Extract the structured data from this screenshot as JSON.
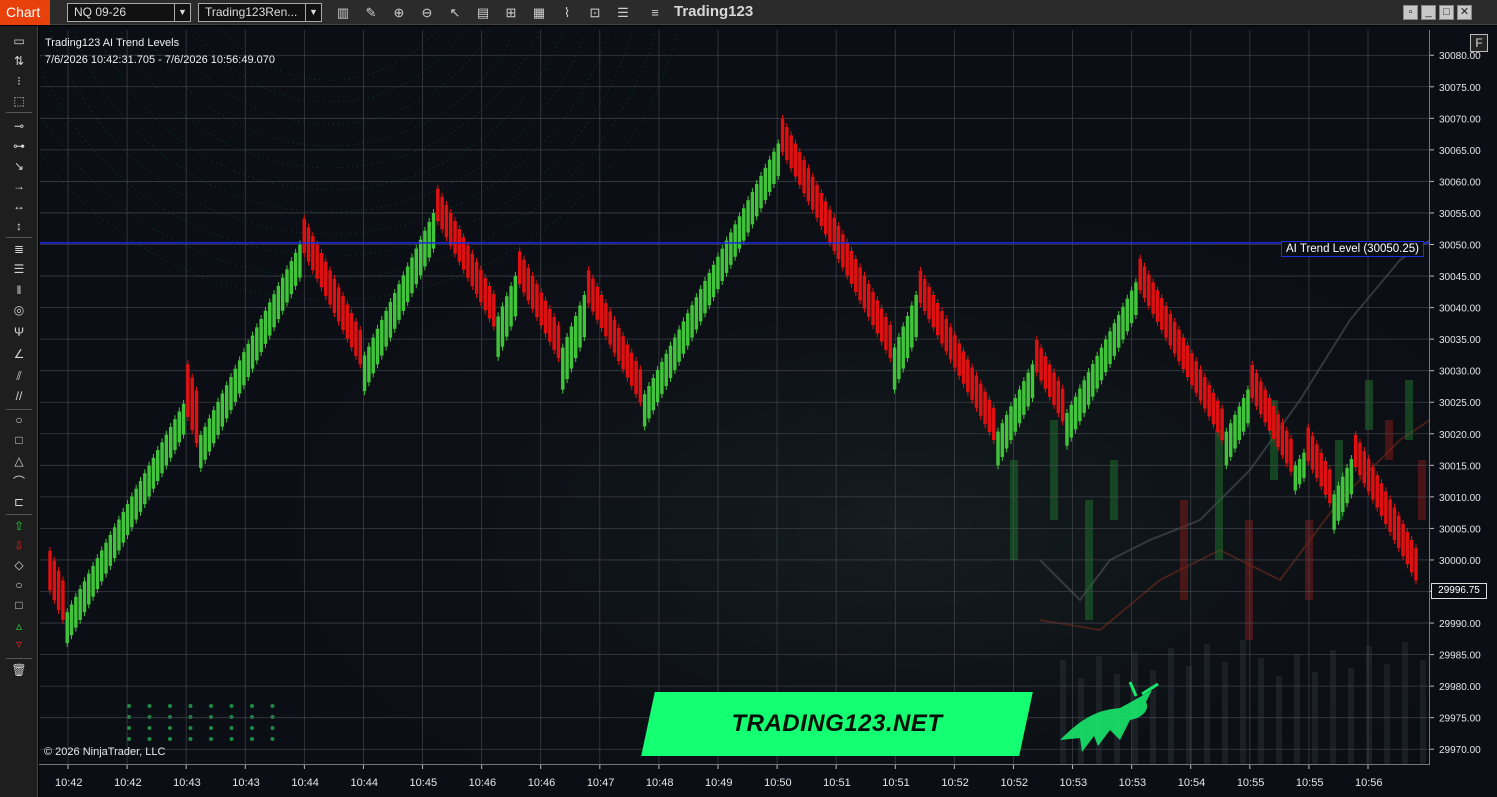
{
  "toolbar": {
    "chart_tab": "Chart",
    "instrument": "NQ 09-26",
    "template": "Trading123Ren...",
    "app_title": "Trading123",
    "icons": [
      "bars-type-icon",
      "pencil-draw-icon",
      "zoom-in-icon",
      "zoom-out-icon",
      "pointer-icon",
      "data-box-icon",
      "properties-icon",
      "indicators-icon",
      "strategies-icon",
      "chart-trader-icon",
      "list-icon",
      "menu-icon"
    ]
  },
  "window_buttons": [
    "restore-icon",
    "minimize-icon",
    "maximize-icon",
    "close-icon"
  ],
  "left_tools": [
    "ruler-icon",
    "risk-reward-icon",
    "region-icon",
    "line-icon",
    "ray-icon",
    "extended-line-icon",
    "arrow-line-icon",
    "horizontal-line-icon",
    "vertical-line-icon",
    "fib-retracement-icon",
    "fib-extension-icon",
    "fib-time-icon",
    "fib-circle-icon",
    "andrews-pitchfork-icon",
    "gann-fan-icon",
    "regression-channel-icon",
    "trend-channel-icon",
    "ellipse-icon",
    "rectangle-icon",
    "triangle-icon",
    "arc-icon",
    "polygon-icon",
    "arrow-up-icon",
    "arrow-down-icon",
    "diamond-icon",
    "dot-icon",
    "square-icon",
    "triangle-up-icon",
    "triangle-down-icon",
    "remove-drawings-icon"
  ],
  "chart": {
    "indicator_name": "Trading123 AI Trend Levels",
    "time_range": "7/6/2026 10:42:31.705 - 7/6/2026 10:56:49.070",
    "copyright": "© 2026 NinjaTrader, LLC",
    "f_button": "F",
    "trend_level_label": "AI Trend Level (30050.25)",
    "trend_level_value": 30050.25,
    "last_price_label": "29996.75",
    "last_price": 29996.75,
    "brand_text": "TRADING123.NET",
    "up_color": "#3fc43a",
    "down_color": "#e11010",
    "trend_line_color": "#1f2de8",
    "price_ticks": [
      "30080.00",
      "30075.00",
      "30070.00",
      "30065.00",
      "30060.00",
      "30055.00",
      "30050.00",
      "30045.00",
      "30040.00",
      "30035.00",
      "30030.00",
      "30025.00",
      "30020.00",
      "30015.00",
      "30010.00",
      "30005.00",
      "30000.00",
      "29995.00",
      "29990.00",
      "29985.00",
      "29980.00",
      "29975.00",
      "29970.00"
    ],
    "time_ticks": [
      "10:42",
      "10:42",
      "10:43",
      "10:43",
      "10:44",
      "10:44",
      "10:45",
      "10:46",
      "10:46",
      "10:47",
      "10:48",
      "10:49",
      "10:50",
      "10:51",
      "10:51",
      "10:52",
      "10:52",
      "10:53",
      "10:53",
      "10:54",
      "10:55",
      "10:55",
      "10:56"
    ]
  },
  "chart_data": {
    "type": "renko-bars",
    "y_range": [
      29967.5,
      30084.0
    ],
    "trend_level": 30050.25,
    "legs": [
      {
        "dir": "down",
        "from": 29996.75,
        "to": 29990.5,
        "bars": 4
      },
      {
        "dir": "up",
        "from": 29990.5,
        "to": 30024.75,
        "bars": 28
      },
      {
        "dir": "down",
        "from": 30024.75,
        "to": 30018.5,
        "bars": 3
      },
      {
        "dir": "up",
        "from": 30018.5,
        "to": 30050.0,
        "bars": 24
      },
      {
        "dir": "down",
        "from": 30050.0,
        "to": 30031.0,
        "bars": 14
      },
      {
        "dir": "up",
        "from": 30031.0,
        "to": 30055.0,
        "bars": 17
      },
      {
        "dir": "down",
        "from": 30055.0,
        "to": 30037.0,
        "bars": 14
      },
      {
        "dir": "up",
        "from": 30037.0,
        "to": 30045.0,
        "bars": 5
      },
      {
        "dir": "down",
        "from": 30045.0,
        "to": 30032.0,
        "bars": 10
      },
      {
        "dir": "up",
        "from": 30032.0,
        "to": 30042.0,
        "bars": 6
      },
      {
        "dir": "down",
        "from": 30042.0,
        "to": 30025.0,
        "bars": 13
      },
      {
        "dir": "up",
        "from": 30025.0,
        "to": 30066.0,
        "bars": 32
      },
      {
        "dir": "down",
        "from": 30066.0,
        "to": 30032.0,
        "bars": 26
      },
      {
        "dir": "up",
        "from": 30032.0,
        "to": 30042.0,
        "bars": 6
      },
      {
        "dir": "down",
        "from": 30042.0,
        "to": 30019.0,
        "bars": 18
      },
      {
        "dir": "up",
        "from": 30019.0,
        "to": 30031.0,
        "bars": 9
      },
      {
        "dir": "down",
        "from": 30031.0,
        "to": 30022.0,
        "bars": 7
      },
      {
        "dir": "up",
        "from": 30022.0,
        "to": 30044.0,
        "bars": 17
      },
      {
        "dir": "down",
        "from": 30044.0,
        "to": 30019.0,
        "bars": 20
      },
      {
        "dir": "up",
        "from": 30019.0,
        "to": 30027.0,
        "bars": 6
      },
      {
        "dir": "down",
        "from": 30027.0,
        "to": 30014.0,
        "bars": 10
      },
      {
        "dir": "up",
        "from": 30014.0,
        "to": 30017.0,
        "bars": 3
      },
      {
        "dir": "down",
        "from": 30017.0,
        "to": 30009.0,
        "bars": 6
      },
      {
        "dir": "up",
        "from": 30009.0,
        "to": 30016.0,
        "bars": 5
      },
      {
        "dir": "down",
        "from": 30016.0,
        "to": 29996.75,
        "bars": 15
      }
    ]
  }
}
